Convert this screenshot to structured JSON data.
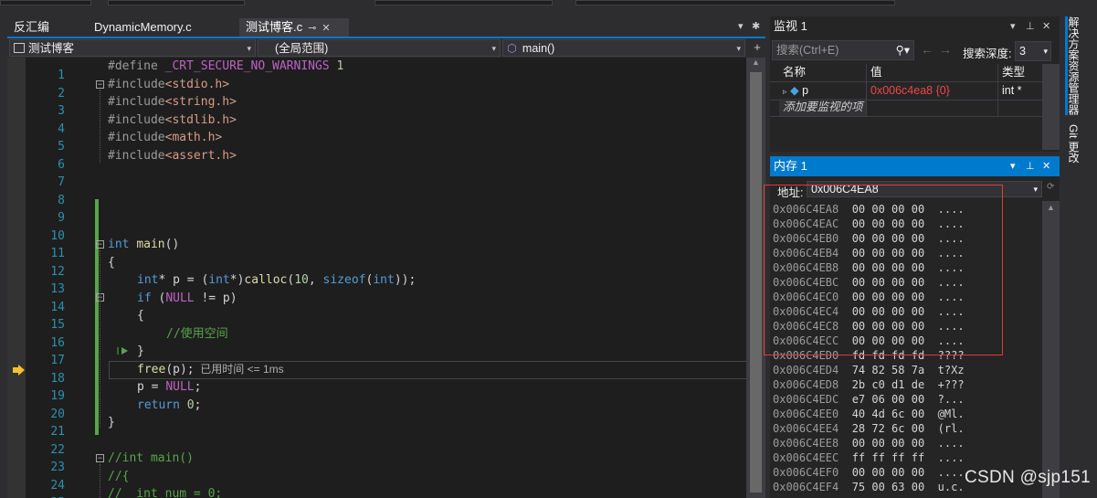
{
  "editor": {
    "tabs": [
      {
        "label": "反汇编",
        "active": false
      },
      {
        "label": "DynamicMemory.c",
        "active": false
      },
      {
        "label": "测试博客.c",
        "active": true
      }
    ],
    "nav": {
      "project": "测试博客",
      "scope": "(全局范围)",
      "function": "main()"
    },
    "current_line_hint": "已用时间 <= 1ms",
    "lines": [
      {
        "n": "1",
        "code": "#define _CRT_SECURE_NO_WARNINGS 1"
      },
      {
        "n": "2",
        "code": "#include<stdio.h>"
      },
      {
        "n": "3",
        "code": "#include<string.h>"
      },
      {
        "n": "4",
        "code": "#include<stdlib.h>"
      },
      {
        "n": "5",
        "code": "#include<math.h>"
      },
      {
        "n": "6",
        "code": "#include<assert.h>"
      },
      {
        "n": "7",
        "code": ""
      },
      {
        "n": "8",
        "code": ""
      },
      {
        "n": "9",
        "code": ""
      },
      {
        "n": "10",
        "code": ""
      },
      {
        "n": "11",
        "code": "int main()"
      },
      {
        "n": "12",
        "code": "{"
      },
      {
        "n": "13",
        "code": "int* p = (int*)calloc(10, sizeof(int));"
      },
      {
        "n": "14",
        "code": "if (NULL != p)"
      },
      {
        "n": "15",
        "code": "{"
      },
      {
        "n": "16",
        "code": "//使用空间"
      },
      {
        "n": "17",
        "code": "}"
      },
      {
        "n": "18",
        "code": "free(p);"
      },
      {
        "n": "19",
        "code": "p = NULL;"
      },
      {
        "n": "20",
        "code": "return 0;"
      },
      {
        "n": "21",
        "code": "}"
      },
      {
        "n": "22",
        "code": ""
      },
      {
        "n": "23",
        "code": "//int main()"
      },
      {
        "n": "24",
        "code": "//{"
      },
      {
        "n": "25",
        "code": "//  int num = 0;"
      }
    ]
  },
  "watch": {
    "title": "监视 1",
    "search_placeholder": "搜索(Ctrl+E)",
    "depth_label": "搜索深度:",
    "depth_value": "3",
    "columns": [
      "名称",
      "值",
      "类型"
    ],
    "rows": [
      {
        "name": "p",
        "value": "0x006c4ea8 {0}",
        "type": "int *"
      }
    ],
    "add_item_text": "添加要监视的项"
  },
  "memory": {
    "title": "内存 1",
    "address_label": "地址:",
    "address_value": "0x006C4EA8",
    "rows": [
      {
        "addr": "0x006C4EA8",
        "bytes": "00 00 00 00",
        "ascii": "...."
      },
      {
        "addr": "0x006C4EAC",
        "bytes": "00 00 00 00",
        "ascii": "...."
      },
      {
        "addr": "0x006C4EB0",
        "bytes": "00 00 00 00",
        "ascii": "...."
      },
      {
        "addr": "0x006C4EB4",
        "bytes": "00 00 00 00",
        "ascii": "...."
      },
      {
        "addr": "0x006C4EB8",
        "bytes": "00 00 00 00",
        "ascii": "...."
      },
      {
        "addr": "0x006C4EBC",
        "bytes": "00 00 00 00",
        "ascii": "...."
      },
      {
        "addr": "0x006C4EC0",
        "bytes": "00 00 00 00",
        "ascii": "...."
      },
      {
        "addr": "0x006C4EC4",
        "bytes": "00 00 00 00",
        "ascii": "...."
      },
      {
        "addr": "0x006C4EC8",
        "bytes": "00 00 00 00",
        "ascii": "...."
      },
      {
        "addr": "0x006C4ECC",
        "bytes": "00 00 00 00",
        "ascii": "...."
      },
      {
        "addr": "0x006C4ED0",
        "bytes": "fd fd fd fd",
        "ascii": "????"
      },
      {
        "addr": "0x006C4ED4",
        "bytes": "74 82 58 7a",
        "ascii": "t?Xz"
      },
      {
        "addr": "0x006C4ED8",
        "bytes": "2b c0 d1 de",
        "ascii": "+???"
      },
      {
        "addr": "0x006C4EDC",
        "bytes": "e7 06 00 00",
        "ascii": "?..."
      },
      {
        "addr": "0x006C4EE0",
        "bytes": "40 4d 6c 00",
        "ascii": "@Ml."
      },
      {
        "addr": "0x006C4EE4",
        "bytes": "28 72 6c 00",
        "ascii": "(rl."
      },
      {
        "addr": "0x006C4EE8",
        "bytes": "00 00 00 00",
        "ascii": "...."
      },
      {
        "addr": "0x006C4EEC",
        "bytes": "ff ff ff ff",
        "ascii": "...."
      },
      {
        "addr": "0x006C4EF0",
        "bytes": "00 00 00 00",
        "ascii": "...."
      },
      {
        "addr": "0x006C4EF4",
        "bytes": "75 00 63 00",
        "ascii": "u.c."
      }
    ]
  },
  "sidebar": {
    "tabs": [
      "解决方案资源管理器",
      "Git 更改"
    ]
  },
  "watermark": "CSDN @sjp151",
  "colors": {
    "accent": "#007acc",
    "keyword": "#569cd6",
    "include_path": "#d69d85",
    "comment": "#57a64a",
    "line_number": "#2b91af",
    "highlight_box": "#e53935"
  }
}
